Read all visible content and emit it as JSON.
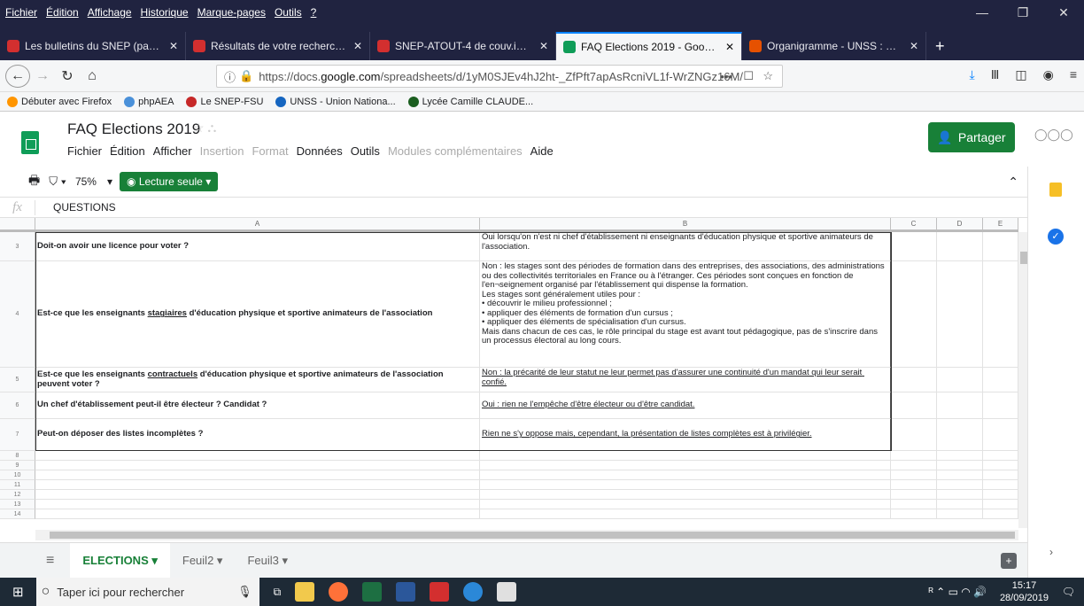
{
  "menubar": [
    "Fichier",
    "Édition",
    "Affichage",
    "Historique",
    "Marque-pages",
    "Outils",
    "?"
  ],
  "tabs": [
    {
      "title": "Les bulletins du SNEP (page d'a",
      "color": "#d32f2f"
    },
    {
      "title": "Résultats de votre recherche su",
      "color": "#d32f2f"
    },
    {
      "title": "SNEP-ATOUT-4 de couv.indd -",
      "color": "#d32f2f"
    },
    {
      "title": "FAQ Elections 2019 - Google Sh",
      "color": "#0f9d58"
    },
    {
      "title": "Organigramme - UNSS : UNSS",
      "color": "#e65100"
    }
  ],
  "url": {
    "prefix": "https://docs.",
    "domain": "google.com",
    "path": "/spreadsheets/d/1yM0SJEv4hJ2ht-_ZfPft7apAsRcniVL1f-WrZNGz16M/"
  },
  "bookmarks": [
    {
      "label": "Débuter avec Firefox",
      "color": "#ff9500"
    },
    {
      "label": "phpAEA",
      "color": "#4a90d9"
    },
    {
      "label": "Le SNEP-FSU",
      "color": "#c62828"
    },
    {
      "label": "UNSS - Union Nationa...",
      "color": "#1565c0"
    },
    {
      "label": "Lycée Camille CLAUDE...",
      "color": "#1b5e20"
    }
  ],
  "doc": {
    "title": "FAQ Elections 2019",
    "menu": [
      {
        "label": "Fichier",
        "dim": false
      },
      {
        "label": "Édition",
        "dim": false
      },
      {
        "label": "Afficher",
        "dim": false
      },
      {
        "label": "Insertion",
        "dim": true
      },
      {
        "label": "Format",
        "dim": true
      },
      {
        "label": "Données",
        "dim": false
      },
      {
        "label": "Outils",
        "dim": false
      },
      {
        "label": "Modules complémentaires",
        "dim": true
      },
      {
        "label": "Aide",
        "dim": false
      }
    ],
    "share": "Partager"
  },
  "toolbar": {
    "zoom": "75%",
    "readonly": "Lecture seule"
  },
  "formula": {
    "value": "QUESTIONS"
  },
  "columns": [
    "A",
    "B",
    "C",
    "D",
    "E"
  ],
  "rows": [
    {
      "num": "3",
      "a": "Doit-on avoir une licence pour voter ?",
      "b": "Oui lorsqu'on n'est ni chef d'établissement ni enseignants d'éducation physique et sportive animateurs de l'association."
    },
    {
      "num": "4",
      "a_pre": "Est-ce que les enseignants ",
      "a_ul": "stagiaires",
      "a_post": " d'éducation physique et sportive animateurs de l'association",
      "b": "Non : les stages sont des périodes de formation dans des entreprises, des associations, des administrations ou des collectivités territoriales en France ou à l'étranger. Ces périodes sont conçues en fonction de l'en¬seignement organisé par l'établissement qui dispense la formation.\nLes stages sont généralement utiles pour :\n• découvrir le milieu professionnel ;\n• appliquer des éléments de formation d'un cursus ;\n• appliquer des éléments de spécialisation d'un cursus.\nMais dans chacun de ces cas, le rôle principal du stage est avant tout pédagogique, pas de s'inscrire dans un processus électoral au long cours."
    },
    {
      "num": "5",
      "a_pre": "Est-ce que les enseignants ",
      "a_ul": "contractuels",
      "a_post": " d'éducation physique et sportive animateurs de l'association peuvent voter ?",
      "b": "Non : la précarité de leur statut ne leur permet pas d'assurer une continuité d'un mandat qui leur serait confié."
    },
    {
      "num": "6",
      "a": "Un chef d'établissement peut-il être électeur ? Candidat ?",
      "b": "Oui : rien ne l'empêche d'être électeur ou d'être candidat."
    },
    {
      "num": "7",
      "a": "Peut-on déposer des listes incomplètes ?",
      "b": "Rien ne s'y oppose mais, cependant, la présentation de listes complètes est à privilégier."
    }
  ],
  "empty_rows": [
    "8",
    "9",
    "10",
    "11",
    "12",
    "13",
    "14"
  ],
  "sheets": [
    {
      "label": "ELECTIONS"
    },
    {
      "label": "Feuil2"
    },
    {
      "label": "Feuil3"
    }
  ],
  "taskbar": {
    "search": "Taper ici pour rechercher",
    "time": "15:17",
    "date": "28/09/2019"
  }
}
